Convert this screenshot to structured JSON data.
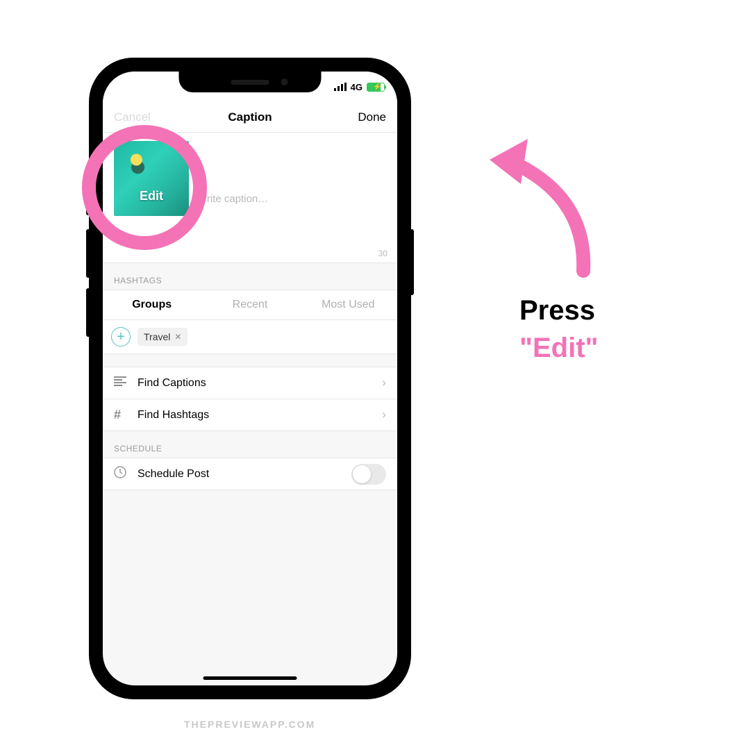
{
  "colors": {
    "accent_pink": "#f472b6",
    "accent_teal": "#5bc0be",
    "battery_green": "#34c759"
  },
  "status": {
    "network": "4G"
  },
  "nav": {
    "cancel": "Cancel",
    "title": "Caption",
    "done": "Done"
  },
  "caption": {
    "placeholder": "Write caption…",
    "counter": "30",
    "thumb_label": "Edit"
  },
  "hashtags": {
    "section": "HASHTAGS",
    "tabs": {
      "groups": "Groups",
      "recent": "Recent",
      "most_used": "Most Used"
    },
    "chip": "Travel"
  },
  "rows": {
    "find_captions": "Find Captions",
    "find_hashtags": "Find Hashtags"
  },
  "schedule": {
    "section": "SCHEDULE",
    "row": "Schedule Post"
  },
  "instruction": {
    "line1": "Press",
    "line2": "\"Edit\""
  },
  "watermark": "THEPREVIEWAPP.COM"
}
